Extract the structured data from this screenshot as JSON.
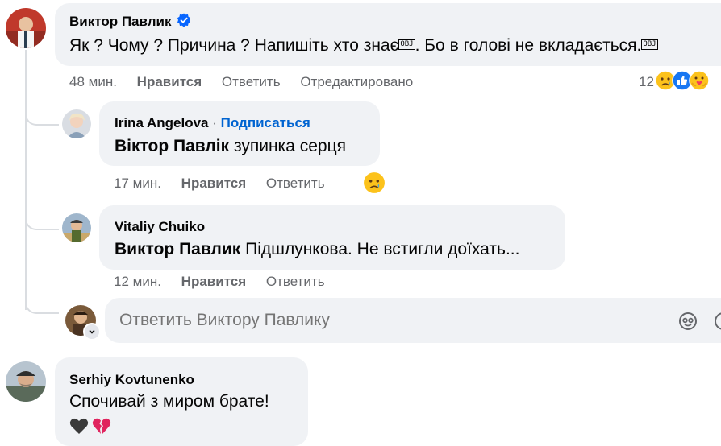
{
  "comments": [
    {
      "author": "Виктор Павлик",
      "verified": true,
      "text_part1": "Як ? Чому ? Причина ? Напишіть хто знає",
      "text_part2": ". Бо в голові не вкладається.",
      "time": "48 мин.",
      "like": "Нравится",
      "reply": "Ответить",
      "edited": "Отредактировано",
      "reaction_count": "12"
    }
  ],
  "replies": [
    {
      "author": "Irina Angelova",
      "separator": "·",
      "follow": "Подписаться",
      "mention": "Віктор Павлік",
      "text": "зупинка серця",
      "time": "17 мин.",
      "like": "Нравится",
      "reply": "Ответить"
    },
    {
      "author": "Vitaliy Chuiko",
      "mention": "Виктор Павлик",
      "text": "Підшлункова. Не встигли доїхать...",
      "time": "12 мин.",
      "like": "Нравится",
      "reply": "Ответить"
    }
  ],
  "reply_box": {
    "placeholder": "Ответить Виктору Павлику"
  },
  "next_comment": {
    "author": "Serhiy Kovtunenko",
    "text": "Спочивай з миром брате!",
    "emoji": "🖤💔"
  },
  "icons": {
    "verified": "verified-badge-icon",
    "obj": "OBJ"
  },
  "colors": {
    "bubble": "#f0f2f5",
    "link": "#0064d1",
    "meta": "#65676b",
    "verified": "#0866ff"
  }
}
